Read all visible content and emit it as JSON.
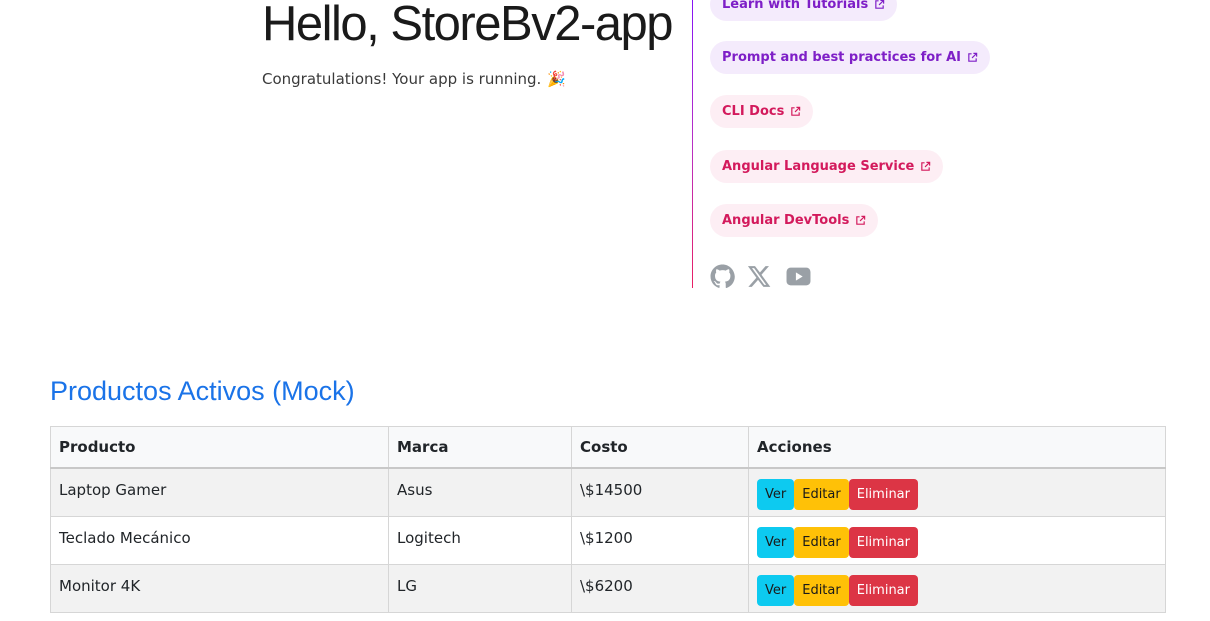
{
  "hero": {
    "title": "Hello, StoreBv2-app",
    "subtitle": "Congratulations! Your app is running.",
    "party_emoji": "🎉"
  },
  "links": [
    {
      "label": "Learn with Tutorials",
      "color": "purple",
      "icon": "external-link-icon"
    },
    {
      "label": "Prompt and best practices for AI",
      "color": "purple",
      "icon": "external-link-icon"
    },
    {
      "label": "CLI Docs",
      "color": "pink",
      "icon": "external-link-icon"
    },
    {
      "label": "Angular Language Service",
      "color": "pink",
      "icon": "external-link-icon"
    },
    {
      "label": "Angular DevTools",
      "color": "pink",
      "icon": "external-link-icon"
    }
  ],
  "social": [
    "github-icon",
    "x-icon",
    "youtube-icon"
  ],
  "products_section": {
    "title": "Productos Activos (Mock)",
    "columns": [
      "Producto",
      "Marca",
      "Costo",
      "Acciones"
    ],
    "rows": [
      {
        "producto": "Laptop Gamer",
        "marca": "Asus",
        "costo": "\\$14500"
      },
      {
        "producto": "Teclado Mecánico",
        "marca": "Logitech",
        "costo": "\\$1200"
      },
      {
        "producto": "Monitor 4K",
        "marca": "LG",
        "costo": "\\$6200"
      }
    ],
    "actions": {
      "ver": "Ver",
      "editar": "Editar",
      "eliminar": "Eliminar"
    }
  },
  "colors": {
    "accent_blue": "#1a73e8",
    "purple_text": "#7e1fc7",
    "pink_text": "#d31a5c",
    "btn_info": "#0dcaf0",
    "btn_warning": "#ffc107",
    "btn_danger": "#dc3545"
  }
}
